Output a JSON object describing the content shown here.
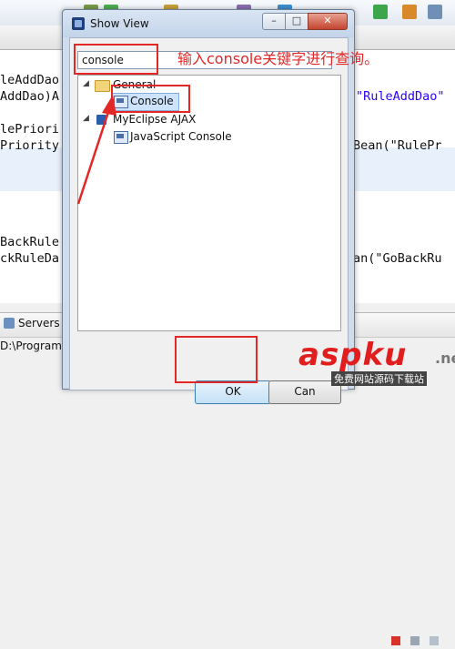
{
  "editor": {
    "lines": [
      {
        "left": "leAddDao",
        "right": ""
      },
      {
        "left": "AddDao)A",
        "right": "\"RuleAddDao\""
      },
      {
        "left": "lePriori",
        "right": ""
      },
      {
        "left": "Priority",
        "right": "Bean(\"RulePr"
      },
      {
        "left": "BackRule",
        "right": ""
      },
      {
        "left": "ckRuleDa",
        "right": "an(\"GoBackRu"
      }
    ]
  },
  "bottom_panel": {
    "servers_tab": "Servers",
    "console_text": "D:\\Program F"
  },
  "dialog": {
    "title": "Show View",
    "filter_value": "console",
    "tree": {
      "group1": "General",
      "group1_child": "Console",
      "group2": "MyEclipse AJAX",
      "group2_child": "JavaScript Console"
    },
    "ok_label": "OK",
    "cancel_label": "Can"
  },
  "annotation": {
    "text": "输入console关键字进行查询。",
    "color": "#e32626"
  },
  "watermark": {
    "main": "aspku",
    "sub": "免费网站源码下载站"
  }
}
